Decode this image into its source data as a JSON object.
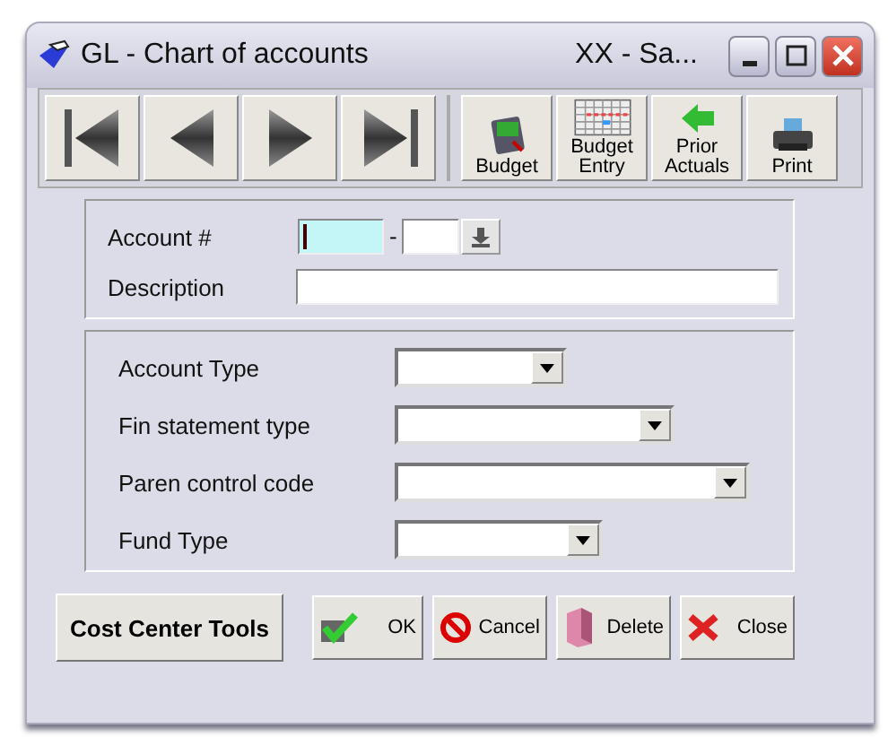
{
  "window": {
    "title": "GL - Chart of accounts",
    "subtitle": "XX  - Sa..."
  },
  "toolbar": {
    "nav_buttons": [
      {
        "kind": "first"
      },
      {
        "kind": "prev"
      },
      {
        "kind": "next"
      },
      {
        "kind": "last"
      }
    ],
    "buttons": [
      {
        "kind": "budget",
        "label": "Budget"
      },
      {
        "kind": "entry",
        "label": "Budget Entry"
      },
      {
        "kind": "prior",
        "label": "Prior Actuals"
      },
      {
        "kind": "print",
        "label": "Print"
      }
    ]
  },
  "account": {
    "label": "Account #",
    "separator": "-",
    "focused": true
  },
  "description": {
    "label": "Description"
  },
  "dropdowns": [
    {
      "label": "Account Type"
    },
    {
      "label": "Fin statement type"
    },
    {
      "label": "Paren control code"
    },
    {
      "label": "Fund Type"
    }
  ],
  "buttons": [
    {
      "kind": "tools",
      "label": "Cost Center Tools"
    },
    {
      "kind": "ok",
      "label": "OK"
    },
    {
      "kind": "cancel",
      "label": "Cancel"
    },
    {
      "kind": "delete",
      "label": "Delete"
    },
    {
      "kind": "close",
      "label": "Close"
    }
  ]
}
